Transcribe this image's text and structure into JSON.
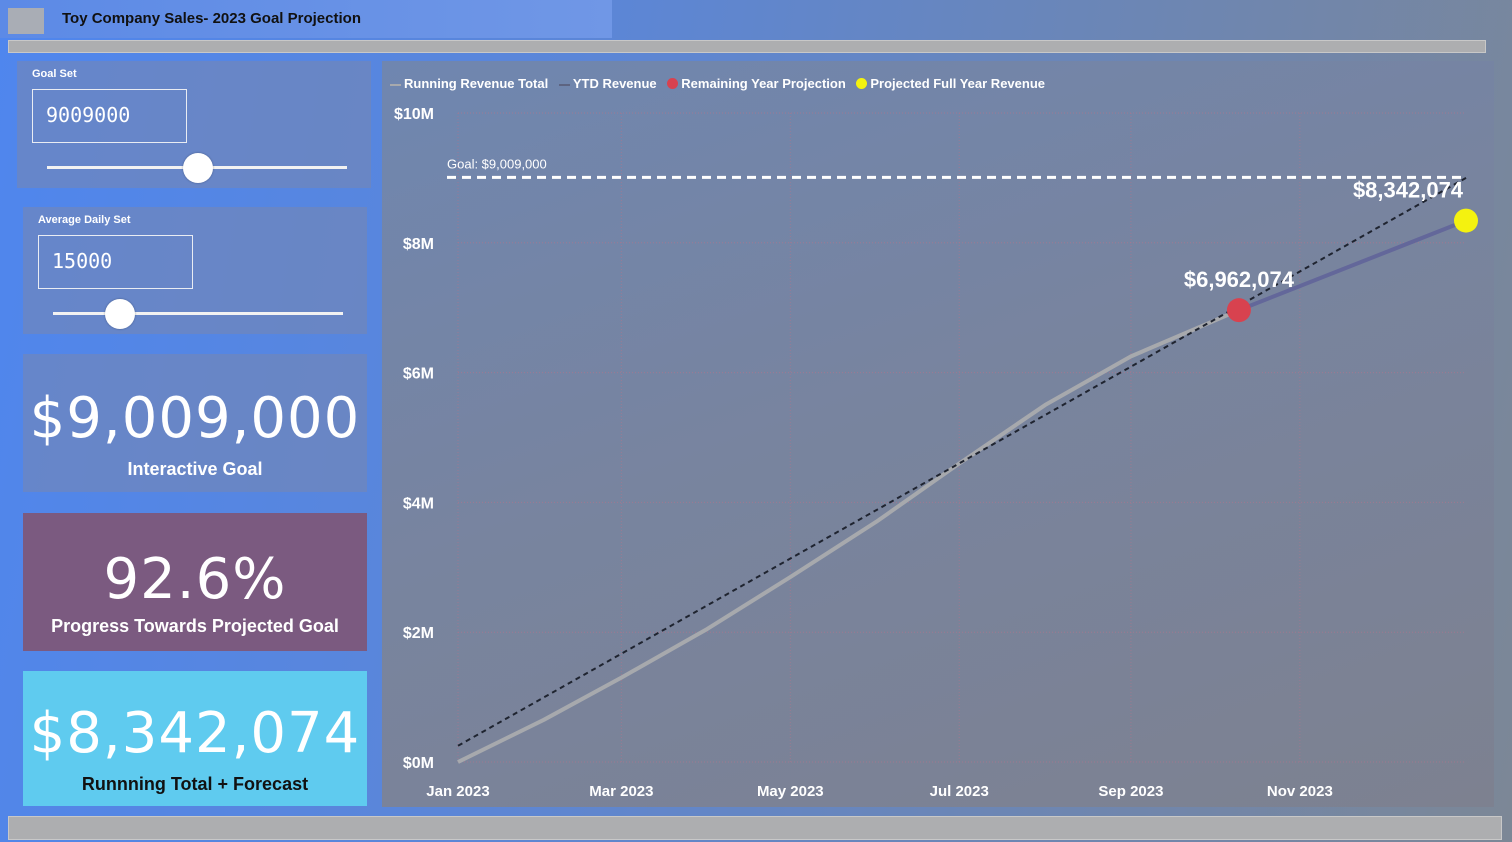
{
  "app": {
    "title": "Toy Company Sales- 2023 Goal Projection"
  },
  "slicers": {
    "goal_set": {
      "label": "Goal Set",
      "value": "9009000",
      "level": 0.5
    },
    "average_daily_set": {
      "label": "Average Daily Set",
      "value": "15000",
      "level": 0.23
    }
  },
  "cards": {
    "goal": {
      "value": "$9,009,000",
      "label": "Interactive Goal"
    },
    "progress": {
      "value": "92.6%",
      "label": "Progress Towards Projected Goal",
      "color": "#7b5a80"
    },
    "total": {
      "value": "$8,342,074",
      "label": "Runnning Total + Forecast",
      "color": "#5fcbef"
    }
  },
  "legend": {
    "running": "Running Revenue Total",
    "ytd": "YTD Revenue",
    "remaining": "Remaining Year Projection",
    "projected": "Projected Full Year Revenue"
  },
  "chart_data": {
    "type": "line",
    "ylim": [
      0,
      10000000
    ],
    "xlim": [
      "2023-01-01",
      "2023-12-31"
    ],
    "y_ticks": [
      0,
      2000000,
      4000000,
      6000000,
      8000000,
      10000000
    ],
    "y_tick_labels": [
      "$0M",
      "$2M",
      "$4M",
      "$6M",
      "$8M",
      "$10M"
    ],
    "x_ticks": [
      "2023-01-01",
      "2023-03-01",
      "2023-05-01",
      "2023-07-01",
      "2023-09-01",
      "2023-11-01"
    ],
    "x_tick_labels": [
      "Jan 2023",
      "Mar 2023",
      "May 2023",
      "Jul 2023",
      "Sep 2023",
      "Nov 2023"
    ],
    "goal_line": {
      "value": 9009000,
      "label": "Goal: $9,009,000"
    },
    "series": [
      {
        "name": "Running Revenue Total",
        "color": "#a7a9ad",
        "points": [
          [
            "2023-01-01",
            0
          ],
          [
            "2023-02-01",
            650000
          ],
          [
            "2023-03-01",
            1300000
          ],
          [
            "2023-04-01",
            2050000
          ],
          [
            "2023-05-01",
            2850000
          ],
          [
            "2023-06-01",
            3700000
          ],
          [
            "2023-07-01",
            4600000
          ],
          [
            "2023-08-01",
            5500000
          ],
          [
            "2023-09-01",
            6250000
          ],
          [
            "2023-10-10",
            6962074
          ]
        ]
      },
      {
        "name": "Remaining Year Projection",
        "color": "#63679a",
        "points": [
          [
            "2023-10-10",
            6962074
          ],
          [
            "2023-12-31",
            8342074
          ]
        ]
      },
      {
        "name": "trend",
        "color": "#1f2430",
        "dashed": true,
        "points": [
          [
            "2023-01-01",
            250000
          ],
          [
            "2023-12-31",
            9000000
          ]
        ]
      }
    ],
    "markers": [
      {
        "name": "Remaining Year Projection",
        "x": "2023-10-10",
        "y": 6962074,
        "label": "$6,962,074",
        "color": "#d8424f"
      },
      {
        "name": "Projected Full Year Revenue",
        "x": "2023-12-31",
        "y": 8342074,
        "label": "$8,342,074",
        "color": "#f4f20f"
      }
    ],
    "grid": true,
    "legend_position": "top-left"
  }
}
